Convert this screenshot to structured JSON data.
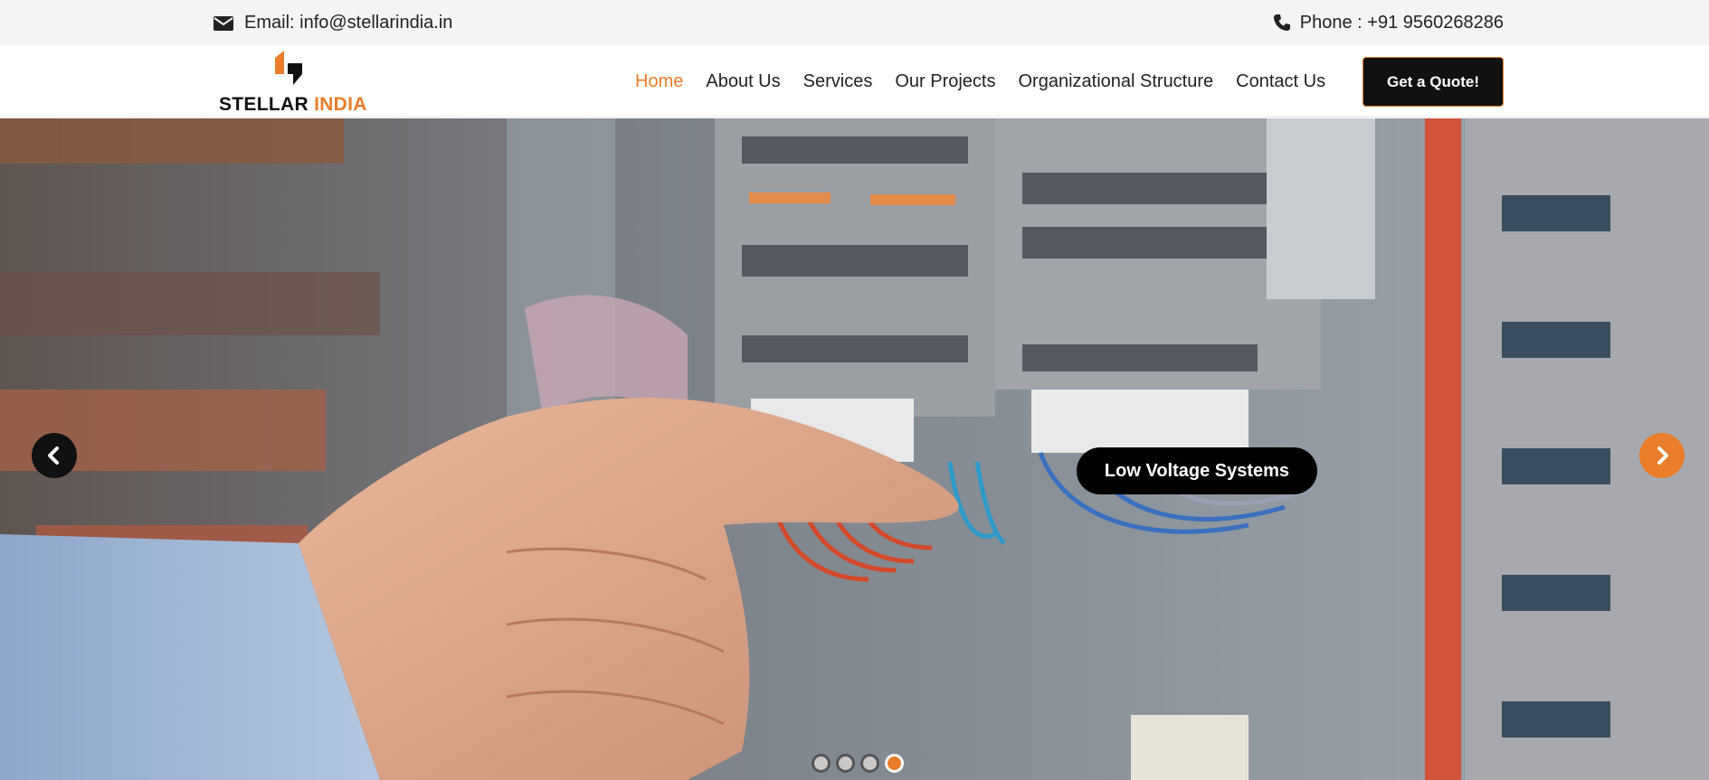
{
  "topbar": {
    "email_icon": "envelope-icon",
    "email": "Email: info@stellarindia.in",
    "phone_icon": "phone-icon",
    "phone": "Phone : +91 9560268286"
  },
  "brand": {
    "name_part1": "STELLAR",
    "name_part2": "INDIA",
    "accent_color": "#ea7d2a",
    "dark_color": "#111111"
  },
  "nav": {
    "items": [
      {
        "label": "Home",
        "active": true
      },
      {
        "label": "About Us",
        "active": false
      },
      {
        "label": "Services",
        "active": false
      },
      {
        "label": "Our Projects",
        "active": false
      },
      {
        "label": "Organizational Structure",
        "active": false
      },
      {
        "label": "Contact Us",
        "active": false
      }
    ],
    "cta_label": "Get a Quote!"
  },
  "hero": {
    "caption": "Low Voltage Systems",
    "prev_icon": "chevron-left-icon",
    "next_icon": "chevron-right-icon",
    "slides_count": 4,
    "active_slide": 4
  }
}
